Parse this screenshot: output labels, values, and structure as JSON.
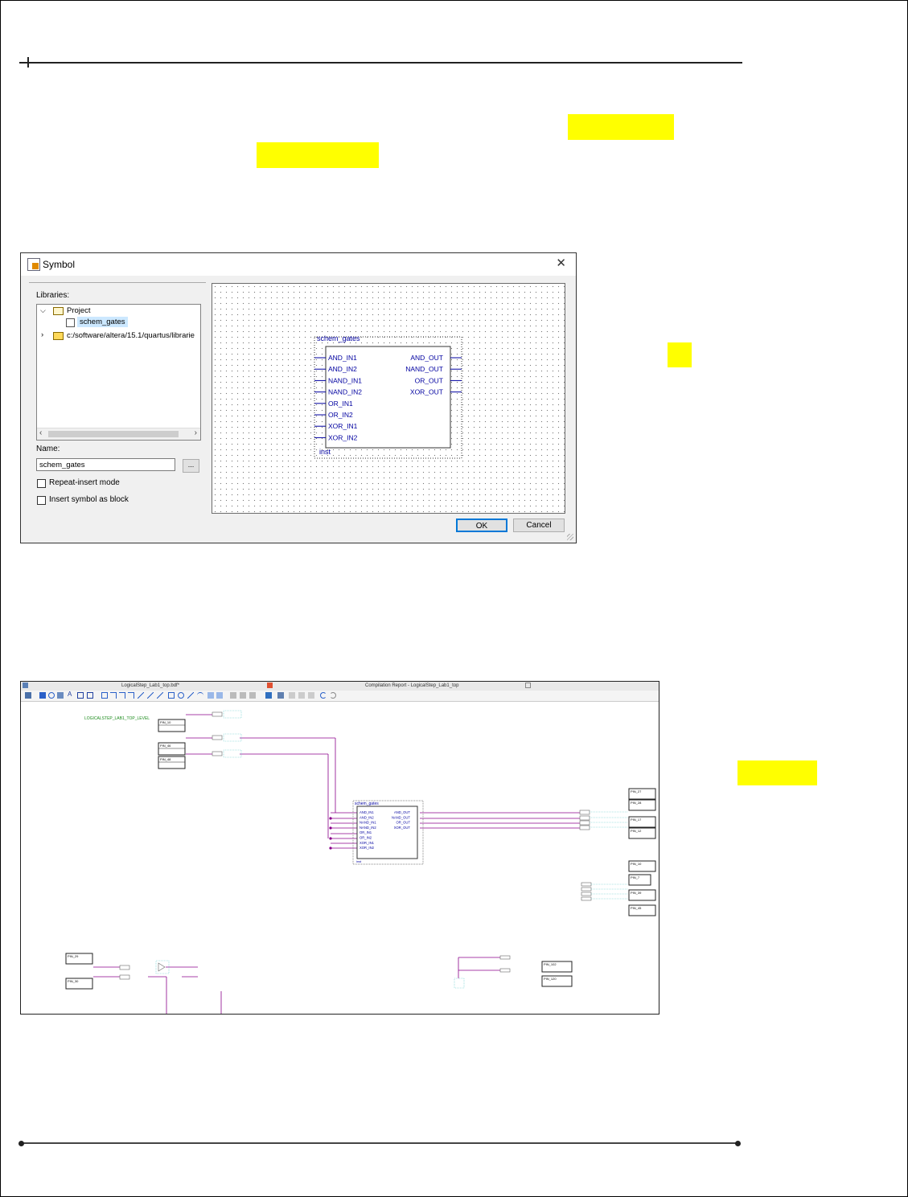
{
  "symbol_dialog": {
    "title": "Symbol",
    "libraries_label": "Libraries:",
    "tree": {
      "project": "Project",
      "project_item": "schem_gates",
      "library_path": "c:/software/altera/15.1/quartus/librarie"
    },
    "name_label": "Name:",
    "name_value": "schem_gates",
    "browse_label": "...",
    "repeat_insert_label": "Repeat-insert mode",
    "insert_block_label": "Insert symbol as block",
    "ok_label": "OK",
    "cancel_label": "Cancel",
    "symbol": {
      "name": "schem_gates",
      "instance": "inst",
      "inputs": [
        "AND_IN1",
        "AND_IN2",
        "NAND_IN1",
        "NAND_IN2",
        "OR_IN1",
        "OR_IN2",
        "XOR_IN1",
        "XOR_IN2"
      ],
      "outputs": [
        "AND_OUT",
        "NAND_OUT",
        "OR_OUT",
        "XOR_OUT"
      ]
    }
  },
  "schematic": {
    "tab_left": "LogicalStep_Lab1_top.bdf*",
    "tab_right": "Compilation Report - LogicalStep_Lab1_top",
    "title_text": "LOGICALSTEP_LAB1_TOP_LEVEL",
    "block_name": "schem_gates",
    "block_inputs": [
      "AND_IN1",
      "AND_IN2",
      "NAND_IN1",
      "NAND_IN2",
      "OR_IN1",
      "OR_IN2",
      "XOR_IN1",
      "XOR_IN2"
    ],
    "block_outputs": [
      "AND_OUT",
      "NAND_OUT",
      "OR_OUT",
      "XOR_OUT"
    ],
    "block_inst": "inst",
    "left_pins": [
      "PIN_10",
      "PIN_46",
      "PIN_48"
    ],
    "right_pins_a": [
      "PIN_27",
      "PIN_28",
      "PIN_17",
      "PIN_12"
    ],
    "right_pins_b": [
      "PIN_10",
      "PIN_7",
      "PIN_39",
      "PIN_45"
    ],
    "bottom_left_pins": [
      "PIN_29",
      "PIN_30"
    ],
    "bottom_right_pins": [
      "PIN_102",
      "PIN_120"
    ]
  },
  "colors": {
    "highlight": "#ffff00",
    "wire": "#8b008b",
    "symbol_text": "#0000a0"
  }
}
